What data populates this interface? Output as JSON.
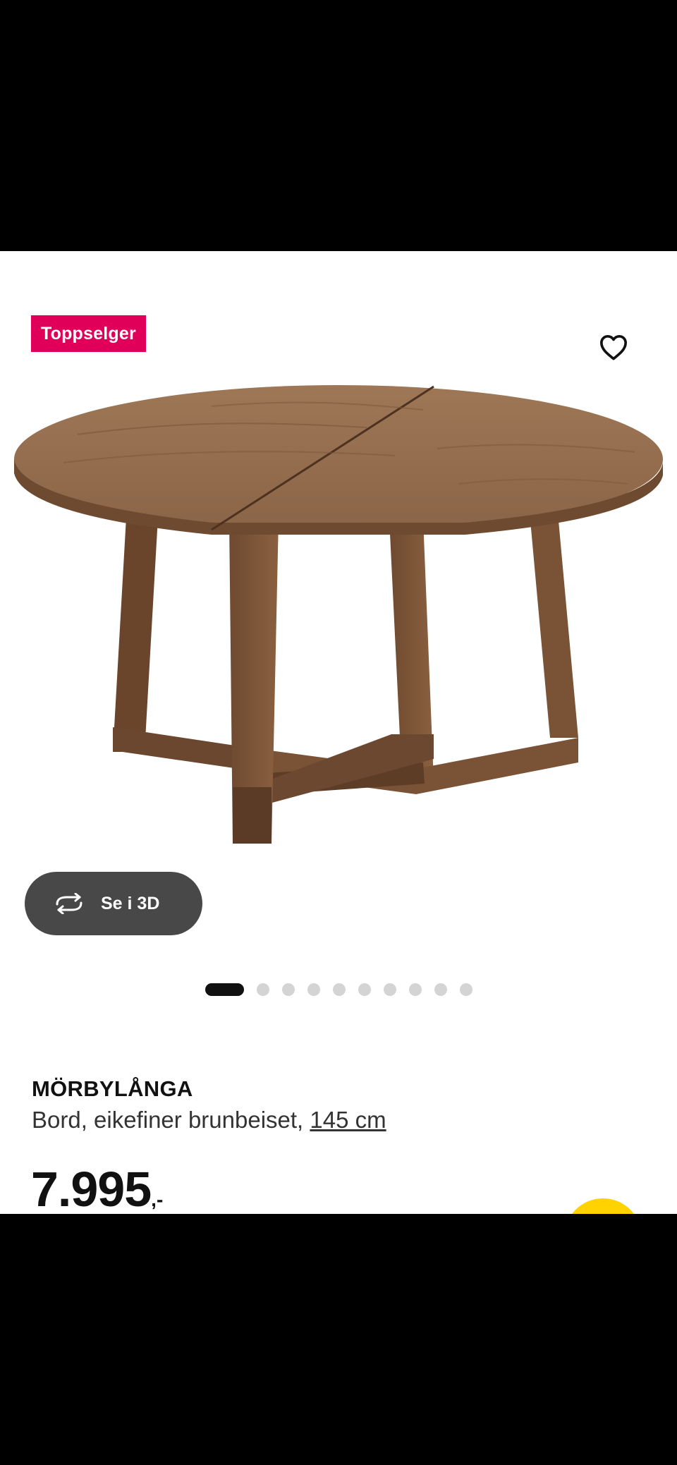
{
  "badge": {
    "label": "Toppselger",
    "color": "#e0005a"
  },
  "favorite": {
    "icon": "heart-outline-icon"
  },
  "viewer": {
    "label": "Se i 3D",
    "icon": "rotate-3d-icon"
  },
  "carousel": {
    "total": 10,
    "active_index": 0
  },
  "product": {
    "name": "MÖRBYLÅNGA",
    "description": "Bord, eikefiner brunbeiset,",
    "size": "145 cm",
    "price": "7.995",
    "price_suffix": ",-"
  },
  "cart_fab": {
    "color": "#ffd200"
  }
}
